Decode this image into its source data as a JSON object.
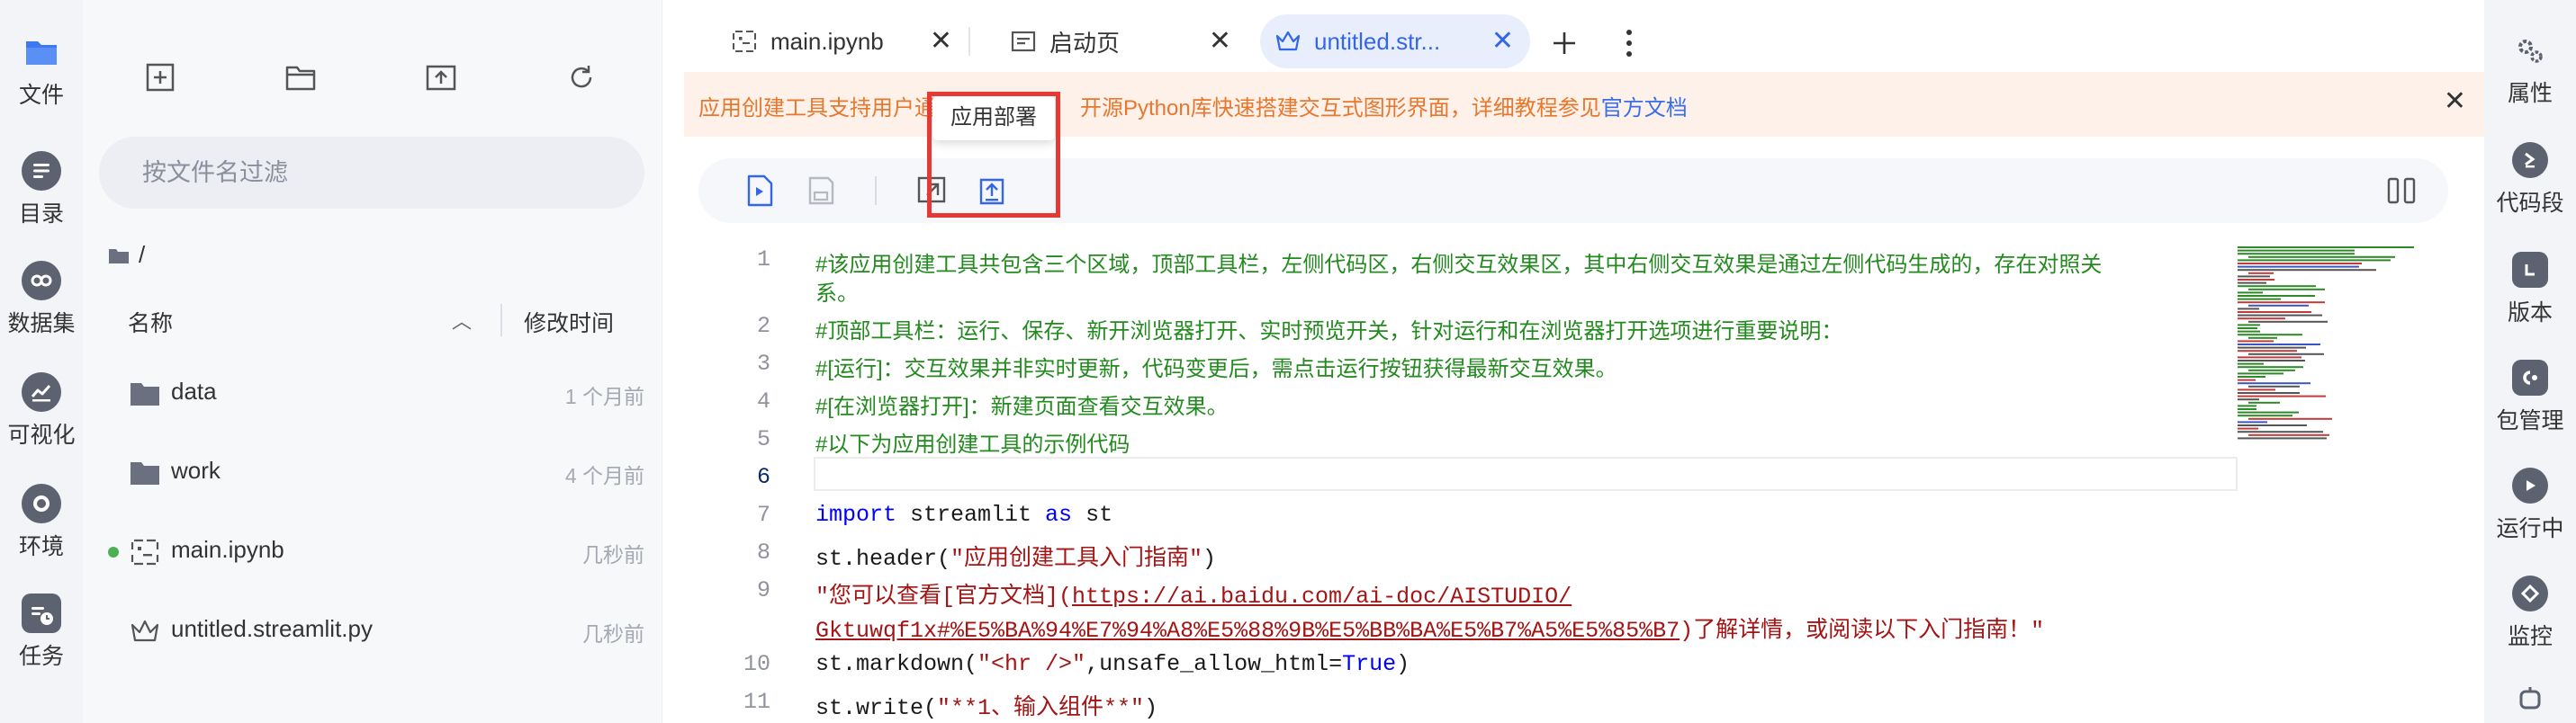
{
  "activity_bar": {
    "items": [
      {
        "label": "文件",
        "icon": "folder-icon",
        "active": true
      },
      {
        "label": "目录",
        "icon": "list-icon"
      },
      {
        "label": "数据集",
        "icon": "dataset-icon"
      },
      {
        "label": "可视化",
        "icon": "chart-icon"
      },
      {
        "label": "环境",
        "icon": "environment-icon"
      },
      {
        "label": "任务",
        "icon": "task-icon"
      }
    ]
  },
  "explorer": {
    "filter_placeholder": "按文件名过滤",
    "root_path": "/",
    "columns": {
      "name": "名称",
      "modified": "修改时间"
    },
    "files": [
      {
        "name": "data",
        "time": "1 个月前",
        "type": "folder"
      },
      {
        "name": "work",
        "time": "4 个月前",
        "type": "folder"
      },
      {
        "name": "main.ipynb",
        "time": "几秒前",
        "type": "notebook",
        "running": true
      },
      {
        "name": "untitled.streamlit.py",
        "time": "几秒前",
        "type": "streamlit"
      }
    ]
  },
  "tabs": [
    {
      "label": "main.ipynb",
      "icon": "notebook-icon"
    },
    {
      "label": "启动页",
      "icon": "launcher-icon"
    },
    {
      "label": "untitled.str...",
      "icon": "crown-icon",
      "active": true
    }
  ],
  "banner": {
    "text_before": "应用创建工具支持用户通",
    "text_after": "开源Python库快速搭建交互式图形界面，详细教程参见",
    "link": "官方文档"
  },
  "tooltip": "应用部署",
  "code": {
    "lines": [
      {
        "n": "1",
        "parts": [
          {
            "t": "#该应用创建工具共包含三个区域，顶部工具栏，左侧代码区，右侧交互效果区，其中右侧交互效果是通过左侧代码生成的，存在对照关",
            "c": "comment"
          }
        ]
      },
      {
        "n": "",
        "parts": [
          {
            "t": "系。",
            "c": "comment"
          }
        ]
      },
      {
        "n": "2",
        "parts": [
          {
            "t": "#顶部工具栏：运行、保存、新开浏览器打开、实时预览开关，针对运行和在浏览器打开选项进行重要说明：",
            "c": "comment"
          }
        ]
      },
      {
        "n": "3",
        "parts": [
          {
            "t": "#[运行]：交互效果并非实时更新，代码变更后，需点击运行按钮获得最新交互效果。",
            "c": "comment"
          }
        ]
      },
      {
        "n": "4",
        "parts": [
          {
            "t": "#[在浏览器打开]：新建页面查看交互效果。",
            "c": "comment"
          }
        ]
      },
      {
        "n": "5",
        "parts": [
          {
            "t": "#以下为应用创建工具的示例代码",
            "c": "comment"
          }
        ]
      },
      {
        "n": "6",
        "parts": []
      },
      {
        "n": "7",
        "parts": [
          {
            "t": "import",
            "c": "keyword"
          },
          {
            "t": " streamlit ",
            "c": ""
          },
          {
            "t": "as",
            "c": "keyword"
          },
          {
            "t": " st",
            "c": ""
          }
        ]
      },
      {
        "n": "8",
        "parts": [
          {
            "t": "st.header(",
            "c": ""
          },
          {
            "t": "\"应用创建工具入门指南\"",
            "c": "string"
          },
          {
            "t": ")",
            "c": ""
          }
        ]
      },
      {
        "n": "9",
        "parts": [
          {
            "t": "\"您可以查看[官方文档](",
            "c": "string"
          },
          {
            "t": "https://ai.baidu.com/ai-doc/AISTUDIO/",
            "c": "link"
          }
        ]
      },
      {
        "n": "",
        "parts": [
          {
            "t": "Gktuwqf1x#%E5%BA%94%E7%94%A8%E5%88%9B%E5%BB%BA%E5%B7%A5%E5%85%B7",
            "c": "link"
          },
          {
            "t": ")了解详情，或阅读以下入门指南！\"",
            "c": "string"
          }
        ]
      },
      {
        "n": "10",
        "parts": [
          {
            "t": "st.markdown(",
            "c": ""
          },
          {
            "t": "\"<hr />\"",
            "c": "string"
          },
          {
            "t": ",unsafe_allow_html=",
            "c": ""
          },
          {
            "t": "True",
            "c": "keyword"
          },
          {
            "t": ")",
            "c": ""
          }
        ]
      },
      {
        "n": "11",
        "parts": [
          {
            "t": "st.write(",
            "c": ""
          },
          {
            "t": "\"**1、输入组件**\"",
            "c": "string"
          },
          {
            "t": ")",
            "c": ""
          }
        ]
      }
    ]
  },
  "right_panel": {
    "items": [
      {
        "label": "属性",
        "icon": "gears-icon"
      },
      {
        "label": "代码段",
        "icon": "snippet-icon"
      },
      {
        "label": "版本",
        "icon": "version-icon"
      },
      {
        "label": "包管理",
        "icon": "package-icon"
      },
      {
        "label": "运行中",
        "icon": "running-icon"
      },
      {
        "label": "监控",
        "icon": "monitor-icon"
      }
    ]
  }
}
